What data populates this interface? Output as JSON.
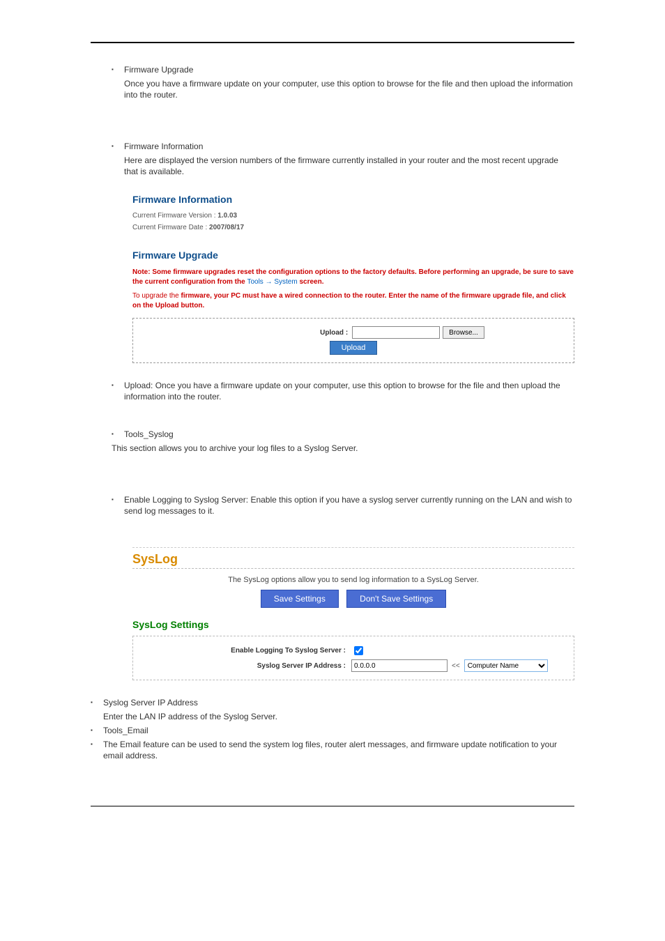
{
  "bullets": {
    "firmware_upgrade_intro": "Firmware Upgrade",
    "firmware_upgrade_body": "Once you have a firmware update on your computer, use this option to browse for the file and then upload the information into the router.",
    "firmware_info_intro": "Firmware Information",
    "firmware_info_body": "Here are displayed the version numbers of the firmware currently installed in your router and the most recent upgrade that is available.",
    "upload_bullet": "Upload: Once you have a firmware update on your computer, use this option to browse for the file and then upload the information into the router.",
    "syslog_title": "Tools_Syslog",
    "syslog_body": "This section allows you to archive your log files to a Syslog Server.",
    "enable_logging_bullet": "Enable Logging to Syslog Server: Enable this option if you have a syslog server currently running on the LAN and wish to send log messages to it.",
    "syslog_ip_intro": "Syslog Server IP Address",
    "syslog_ip_body": "Enter the LAN IP address of the Syslog Server.",
    "email_title": "Tools_Email",
    "email_body": "The Email feature can be used to send the system log files, router alert messages, and firmware update notification to your email address."
  },
  "fw_info": {
    "heading": "Firmware Information",
    "version_label": "Current Firmware Version :",
    "version_value": "1.0.03",
    "date_label": "Current Firmware Date :",
    "date_value": "2007/08/17"
  },
  "fw_upgrade": {
    "heading": "Firmware Upgrade",
    "warn_prefix": "Note: Some firmware upgrades reset the configuration options to the factory defaults. Before performing an upgrade, be sure to save the current configuration from the ",
    "warn_link": "Tools → System",
    "warn_suffix": " screen.",
    "note": "To upgrade the firmware, your PC must have a wired connection to the router. Enter the name of the firmware upgrade file, and click on the Upload button.",
    "upload_label": "Upload :",
    "browse_btn": "Browse...",
    "upload_btn": "Upload"
  },
  "syslog_fig": {
    "title": "SysLog",
    "desc": "The SysLog options allow you to send log information to a SysLog Server.",
    "save_btn": "Save Settings",
    "dont_save_btn": "Don't Save Settings",
    "settings_heading": "SysLog Settings",
    "enable_label": "Enable Logging To Syslog Server :",
    "ip_label": "Syslog Server IP Address :",
    "ip_value": "0.0.0.0",
    "arrows": "<<",
    "select_label": "Computer Name"
  }
}
